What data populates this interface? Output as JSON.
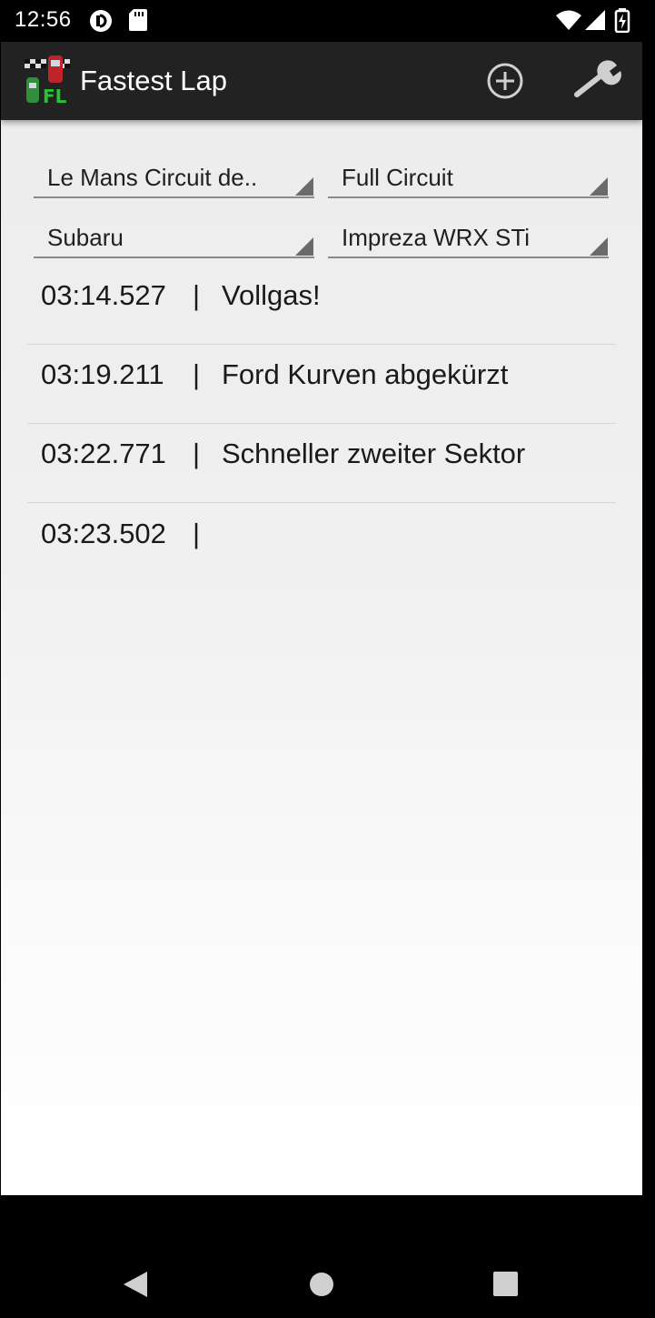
{
  "status_bar": {
    "time": "12:56",
    "icons": [
      "pocket-casts-icon",
      "sd-card-icon",
      "wifi-icon",
      "signal-icon",
      "battery-charging-icon"
    ]
  },
  "action_bar": {
    "title": "Fastest Lap",
    "logo_text": "FL",
    "buttons": [
      "add-circle-icon",
      "wrench-icon"
    ],
    "color": "#222222"
  },
  "filters": {
    "track": "Le Mans Circuit de..",
    "layout": "Full Circuit",
    "manufacturer": "Subaru",
    "model": "Impreza WRX STi"
  },
  "laps": [
    {
      "time": "03:14.527",
      "separator": "|",
      "note": "Vollgas!"
    },
    {
      "time": "03:19.211",
      "separator": "|",
      "note": "Ford Kurven abgekürzt"
    },
    {
      "time": "03:22.771",
      "separator": "|",
      "note": "Schneller zweiter Sektor"
    },
    {
      "time": "03:23.502",
      "separator": "|",
      "note": ""
    }
  ],
  "nav_bar": {
    "buttons": [
      "back-icon",
      "home-icon",
      "recents-icon"
    ]
  }
}
